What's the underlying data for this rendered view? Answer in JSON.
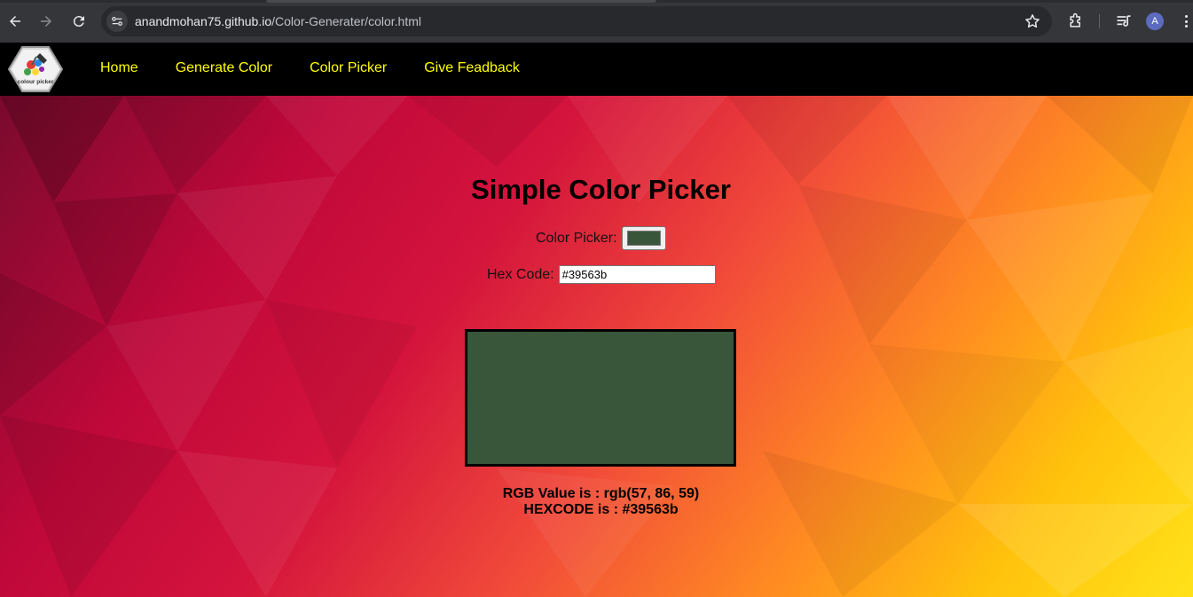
{
  "browser": {
    "url_host": "anandmohan75.github.io",
    "url_path": "/Color-Generater/color.html",
    "profile_initial": "A",
    "icons": [
      "back-arrow-icon",
      "forward-arrow-icon",
      "reload-icon",
      "site-info-icon",
      "star-icon",
      "extensions-icon",
      "reading-list-icon",
      "kebab-menu-icon"
    ]
  },
  "site": {
    "logo_text": "colour picker",
    "nav": [
      {
        "label": "Home"
      },
      {
        "label": "Generate Color"
      },
      {
        "label": "Color Picker"
      },
      {
        "label": "Give Feadback"
      }
    ],
    "nav_color": "#ffff00"
  },
  "main": {
    "title": "Simple Color Picker",
    "picker_label": "Color Picker:",
    "hex_label": "Hex Code:",
    "hex_value": "#39563b",
    "selected_color": "#39563b",
    "rgb_text": "RGB Value is : rgb(57, 86, 59)",
    "hex_text": "HEXCODE is : #39563b"
  }
}
